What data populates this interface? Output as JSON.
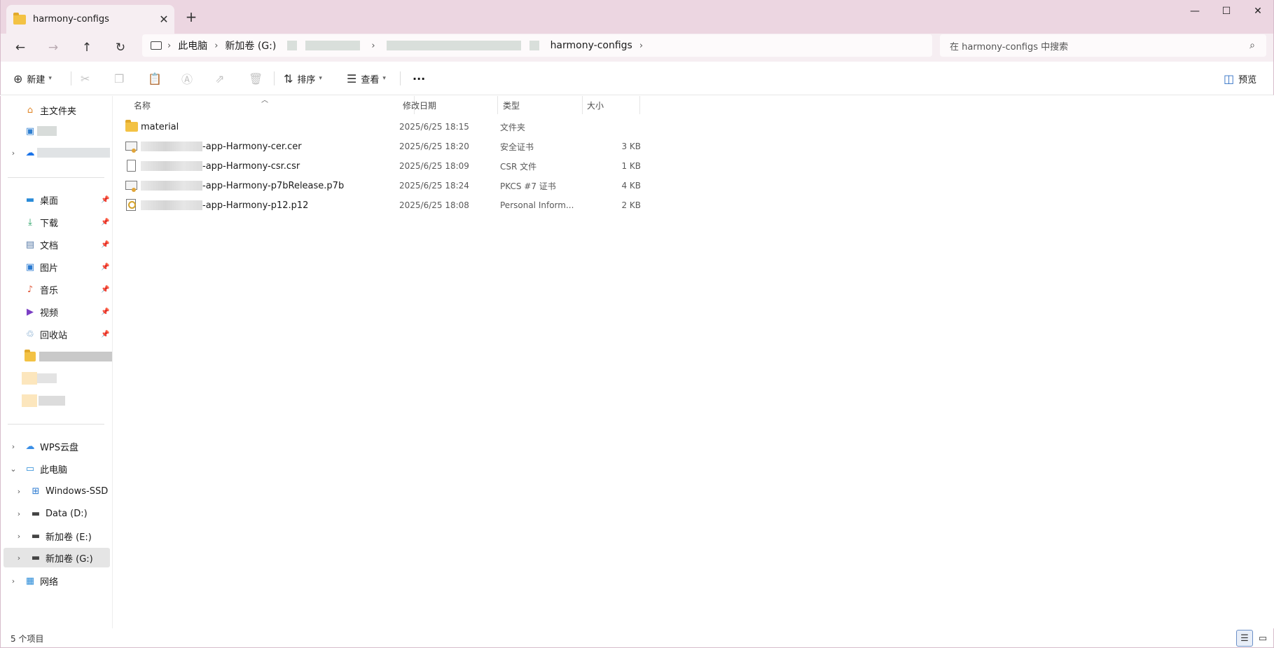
{
  "window": {
    "tab_title": "harmony-configs",
    "close_tab": "✕",
    "new_tab": "+",
    "minimize": "—",
    "maximize": "☐",
    "close": "✕"
  },
  "nav": {
    "back": "←",
    "forward": "→",
    "up": "↑",
    "refresh": "↻"
  },
  "address": {
    "this_pc": "此电脑",
    "drive": "新加卷 (G:)",
    "current": "harmony-configs",
    "sep": "›"
  },
  "search": {
    "placeholder": "在 harmony-configs 中搜索",
    "icon": "search-icon"
  },
  "toolbar": {
    "new_label": "新建",
    "sort_label": "排序",
    "view_label": "查看",
    "more_label": "···",
    "preview_label": "预览"
  },
  "sidebar": {
    "home": "主文件夹",
    "pinned": [
      {
        "label": "桌面",
        "icon": "desktop-icon"
      },
      {
        "label": "下载",
        "icon": "download-icon"
      },
      {
        "label": "文档",
        "icon": "document-icon"
      },
      {
        "label": "图片",
        "icon": "pictures-icon"
      },
      {
        "label": "音乐",
        "icon": "music-icon"
      },
      {
        "label": "视频",
        "icon": "video-icon"
      },
      {
        "label": "回收站",
        "icon": "recycle-bin-icon"
      }
    ],
    "wps": "WPS云盘",
    "this_pc": "此电脑",
    "drives": [
      {
        "label": "Windows-SSD (C"
      },
      {
        "label": "Data (D:)"
      },
      {
        "label": "新加卷 (E:)"
      },
      {
        "label": "新加卷 (G:)"
      }
    ],
    "network": "网络"
  },
  "columns": {
    "name": "名称",
    "date": "修改日期",
    "type": "类型",
    "size": "大小"
  },
  "files": [
    {
      "name": "material",
      "date": "2025/6/25 18:15",
      "type": "文件夹",
      "size": "",
      "icon": "folder-icon"
    },
    {
      "name": "-app-Harmony-cer.cer",
      "date": "2025/6/25 18:20",
      "type": "安全证书",
      "size": "3 KB",
      "icon": "certificate-icon"
    },
    {
      "name": "-app-Harmony-csr.csr",
      "date": "2025/6/25 18:09",
      "type": "CSR 文件",
      "size": "1 KB",
      "icon": "file-icon"
    },
    {
      "name": "-app-Harmony-p7bRelease.p7b",
      "date": "2025/6/25 18:24",
      "type": "PKCS #7 证书",
      "size": "4 KB",
      "icon": "certificate-icon"
    },
    {
      "name": "-app-Harmony-p12.p12",
      "date": "2025/6/25 18:08",
      "type": "Personal Inform...",
      "size": "2 KB",
      "icon": "key-file-icon"
    }
  ],
  "status": {
    "count": "5 个项目"
  }
}
